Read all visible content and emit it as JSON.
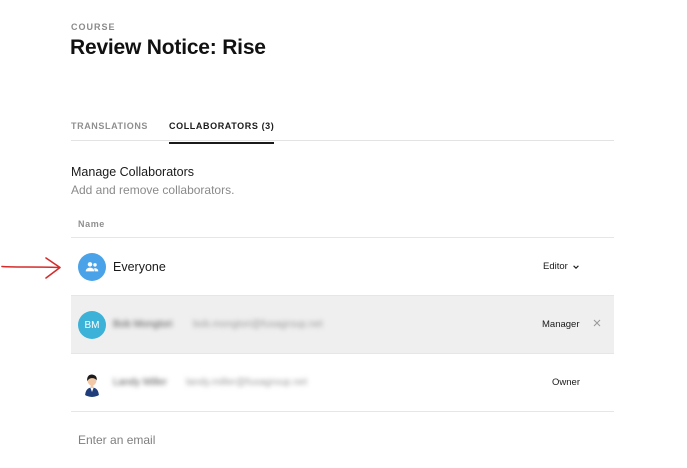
{
  "header": {
    "kicker": "COURSE",
    "title": "Review Notice: Rise"
  },
  "tabs": [
    {
      "label": "TRANSLATIONS",
      "active": false
    },
    {
      "label": "COLLABORATORS (3)",
      "active": true
    }
  ],
  "section": {
    "title": "Manage Collaborators",
    "subtitle": "Add and remove collaborators."
  },
  "table": {
    "name_header": "Name"
  },
  "collaborators": [
    {
      "name": "Everyone",
      "email": "",
      "avatar": "group-icon",
      "role": "Editor",
      "role_editable": true
    },
    {
      "name": "Bob Mongtori",
      "email": "bob.mongtori@fusagroup.net",
      "avatar_initials": "BM",
      "role": "Manager",
      "removable": true
    },
    {
      "name": "Landy Miller",
      "email": "landy.miller@fusagroup.net",
      "avatar": "person-avatar",
      "role": "Owner"
    }
  ],
  "email_input": {
    "placeholder": "Enter an email",
    "value": ""
  },
  "colors": {
    "accent_group": "#4aa3e8",
    "accent_initials": "#3db2d8",
    "annotation_arrow": "#d62b2b",
    "row_highlight": "#efefef"
  },
  "icons": {
    "group": "people-icon",
    "dropdown": "chevron-down-icon",
    "remove": "close-icon",
    "annotation": "arrow-right-icon"
  }
}
